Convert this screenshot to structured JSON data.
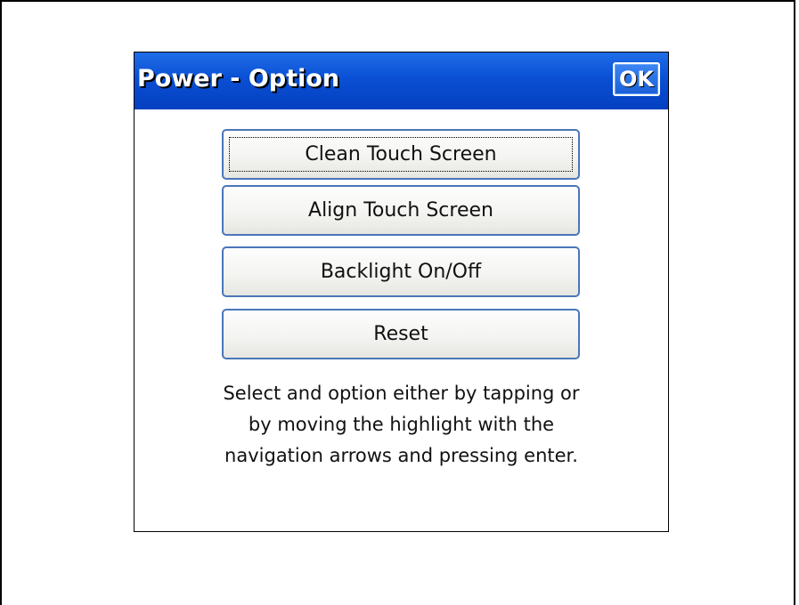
{
  "window": {
    "title": "Power - Option",
    "ok_label": "OK"
  },
  "menu": {
    "items": [
      {
        "label": "Clean Touch Screen",
        "focused": true
      },
      {
        "label": "Align Touch Screen",
        "focused": false
      },
      {
        "label": "Backlight On/Off",
        "focused": false
      },
      {
        "label": "Reset",
        "focused": false
      }
    ]
  },
  "help": {
    "lines": [
      "Select and option either by tapping or",
      "by moving the highlight with the",
      "navigation arrows and pressing enter."
    ]
  },
  "colors": {
    "title_bar": "#0a4fd4",
    "button_border": "#4a76b8",
    "button_face": "#f4f4f2"
  }
}
